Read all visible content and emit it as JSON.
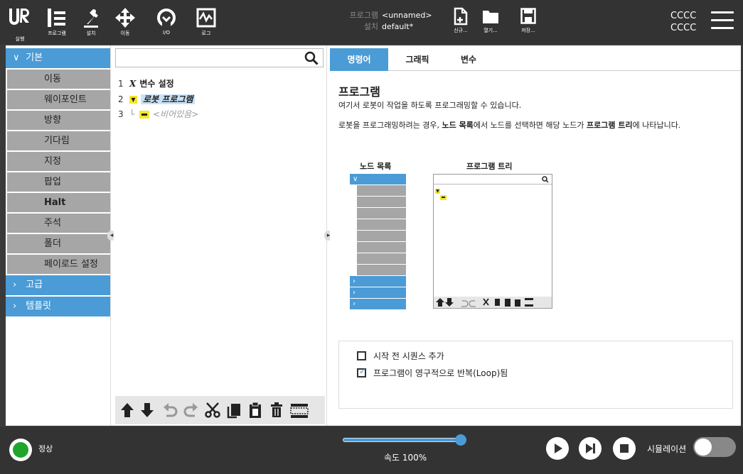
{
  "topbar": {
    "nav": [
      {
        "label": "실행",
        "icon": "run-icon"
      },
      {
        "label": "프로그램",
        "icon": "program-icon",
        "active": true
      },
      {
        "label": "설치",
        "icon": "installation-icon"
      },
      {
        "label": "이동",
        "icon": "move-icon"
      },
      {
        "label": "I/O",
        "icon": "io-icon"
      },
      {
        "label": "로그",
        "icon": "log-icon"
      }
    ],
    "program_label": "프로그램",
    "program_value": "<unnamed>",
    "install_label": "설치",
    "install_value": "default*",
    "file_buttons": [
      {
        "label": "신규...",
        "icon": "new-file-icon"
      },
      {
        "label": "열기...",
        "icon": "open-folder-icon"
      },
      {
        "label": "저장...",
        "icon": "save-icon"
      }
    ],
    "user_line1": "CCCC",
    "user_line2": "CCCC"
  },
  "commands": {
    "basic_label": "기본",
    "basic_items": [
      "이동",
      "웨이포인트",
      "방향",
      "기다림",
      "지정",
      "팝업",
      "Halt",
      "주석",
      "폴더",
      "페이로드 설정"
    ],
    "advanced_label": "고급",
    "templates_label": "템플릿"
  },
  "tree": {
    "search_placeholder": "",
    "rows": [
      {
        "num": "1",
        "icon": "x",
        "text": "변수 설정"
      },
      {
        "num": "2",
        "icon": "triangle",
        "text": "로봇 프로그램"
      },
      {
        "num": "3",
        "icon": "bar",
        "text": "<비어있음>"
      }
    ]
  },
  "right": {
    "tabs": [
      "명령어",
      "그래픽",
      "변수"
    ],
    "title": "프로그램",
    "desc": "여기서 로봇이 작업을 하도록 프로그래밍할 수 있습니다.",
    "instr_a": "로봇을 프로그래밍하려는 경우, ",
    "instr_b": "노드 목록",
    "instr_c": "에서 노드를 선택하면 해당 노드가 ",
    "instr_d": "프로그램 트리",
    "instr_e": "에 나타납니다.",
    "diagram_nodelist": "노드 목록",
    "diagram_progtree": "프로그램 트리",
    "opt1": "시작 전 시퀀스 추가",
    "opt1_checked": false,
    "opt2": "프로그램이 영구적으로 반복(Loop)됨",
    "opt2_checked": true
  },
  "bottom": {
    "status": "정상",
    "speed": "속도 100%",
    "speed_value": 100,
    "simulation": "시뮬레이션",
    "simulation_on": false
  }
}
